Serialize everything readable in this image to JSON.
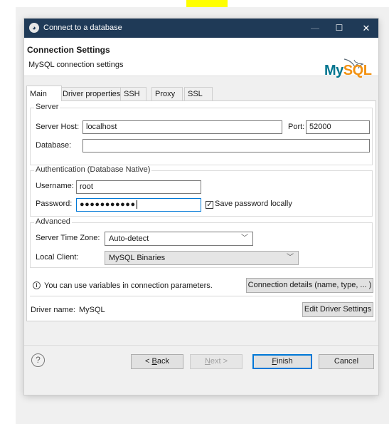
{
  "window": {
    "title": "Connect to a database",
    "controls": {
      "minimize": "—",
      "maximize": "☐",
      "close": "✕"
    }
  },
  "header": {
    "title": "Connection Settings",
    "subtitle": "MySQL connection settings",
    "logo": {
      "my": "My",
      "sql": "SQL",
      "colors": {
        "my": "#00758f",
        "sql": "#f29111"
      }
    }
  },
  "tabs": [
    {
      "label": "Main",
      "active": true
    },
    {
      "label": "Driver properties",
      "active": false
    },
    {
      "label": "SSH",
      "active": false
    },
    {
      "label": "Proxy",
      "active": false
    },
    {
      "label": "SSL",
      "active": false
    }
  ],
  "server": {
    "group_label": "Server",
    "host_label": "Server Host:",
    "host_value": "localhost",
    "port_label": "Port:",
    "port_value": "52000",
    "database_label": "Database:",
    "database_value": ""
  },
  "auth": {
    "group_label": "Authentication (Database Native)",
    "username_label": "Username:",
    "username_value": "root",
    "password_label": "Password:",
    "password_mask": "●●●●●●●●●●●",
    "save_password_label": "Save password locally",
    "save_password_checked": true
  },
  "advanced": {
    "group_label": "Advanced",
    "timezone_label": "Server Time Zone:",
    "timezone_value": "Auto-detect",
    "local_client_label": "Local Client:",
    "local_client_value": "MySQL Binaries"
  },
  "info": {
    "text": "You can use variables in connection parameters.",
    "details_button": "Connection details (name, type, ... )"
  },
  "driver": {
    "label": "Driver name:",
    "value": "MySQL",
    "edit_button": "Edit Driver Settings"
  },
  "footer": {
    "help": "?",
    "back": {
      "prefix": "< ",
      "mnemonic": "B",
      "rest": "ack"
    },
    "next": {
      "mnemonic": "N",
      "rest": "ext >"
    },
    "finish": {
      "mnemonic": "F",
      "rest": "inish"
    },
    "cancel": "Cancel"
  },
  "colors": {
    "titlebar": "#1f3a57",
    "accent": "#0078d7"
  }
}
